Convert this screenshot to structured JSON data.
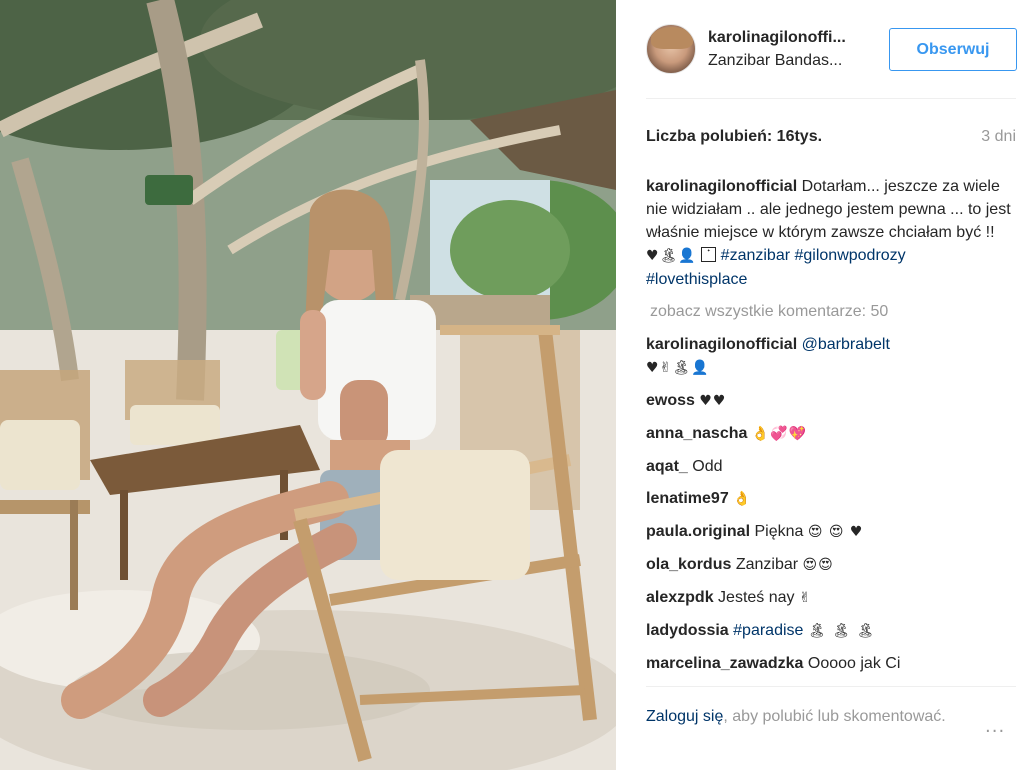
{
  "post": {
    "username": "karolinagilonoffi...",
    "location": "Zanzibar Bandas...",
    "follow_label": "Obserwuj",
    "likes": "Liczba polubień: 16tys.",
    "time_ago": "3 dni"
  },
  "caption": {
    "author": "karolinagilonofficial",
    "text": "Dotarłam... jeszcze za wiele nie widziałam .. ale jednego jestem pewna ... to jest właśnie miejsce w którym zawsze chciałam być !!",
    "emojis": "♥🏝👤",
    "hashtags": [
      "#zanzibar",
      "#gilonwpodrozy",
      "#lovethisplace"
    ]
  },
  "view_all": "zobacz wszystkie komentarze: 50",
  "comments": [
    {
      "user": "karolinagilonofficial",
      "mention": "@barbrabelt",
      "text": "",
      "emoji": "♥✌🏝👤"
    },
    {
      "user": "ewoss",
      "mention": "",
      "text": "",
      "emoji": "♥♥"
    },
    {
      "user": "anna_nascha",
      "mention": "",
      "text": "",
      "emoji": "👌💞💖"
    },
    {
      "user": "aqat_",
      "mention": "",
      "text": "Odd",
      "emoji": ""
    },
    {
      "user": "lenatime97",
      "mention": "",
      "text": "",
      "emoji": "👌"
    },
    {
      "user": "paula.original",
      "mention": "",
      "text": "Piękna",
      "emoji": "😍 😍 ♥"
    },
    {
      "user": "ola_kordus",
      "mention": "",
      "text": "Zanzibar",
      "emoji": "😍😍"
    },
    {
      "user": "alexzpdk",
      "mention": "",
      "text": "Jesteś nay",
      "emoji": "✌"
    },
    {
      "user": "ladydossia",
      "mention": "#paradise",
      "text": "",
      "emoji": "🏝 🏝 🏝"
    },
    {
      "user": "marcelina_zawadzka",
      "mention": "",
      "text": "Ooooo jak Ci",
      "emoji": ""
    }
  ],
  "footer": {
    "login_link": "Zaloguj się",
    "rest": ", aby polubić lub skomentować.",
    "more_label": "..."
  },
  "colors": {
    "link": "#003569",
    "follow": "#3897f0",
    "muted": "#999999"
  }
}
